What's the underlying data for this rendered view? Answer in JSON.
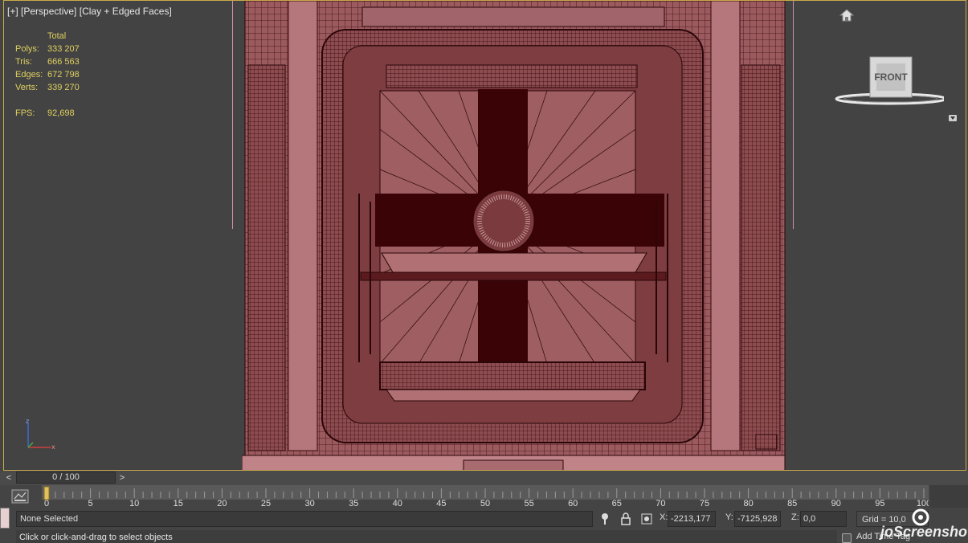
{
  "viewport": {
    "label_plus": "[+]",
    "label_view": "[Perspective]",
    "label_shading": "[Clay + Edged Faces]",
    "stats": {
      "header": "Total",
      "rows": [
        {
          "key": "Polys:",
          "value": "333 207"
        },
        {
          "key": "Tris:",
          "value": "666 563"
        },
        {
          "key": "Edges:",
          "value": "672 798"
        },
        {
          "key": "Verts:",
          "value": "339 270"
        }
      ],
      "fps_key": "FPS:",
      "fps_value": "92,698"
    },
    "viewcube_face": "FRONT",
    "home_icon": "home-icon"
  },
  "time_slider": {
    "prev": "<",
    "next": ">",
    "position": "0 / 100"
  },
  "track": {
    "ticks": [
      "0",
      "5",
      "10",
      "15",
      "20",
      "25",
      "30",
      "35",
      "40",
      "45",
      "50",
      "55",
      "60",
      "65",
      "70",
      "75",
      "80",
      "85",
      "90",
      "95",
      "100"
    ]
  },
  "status": {
    "selection": "None Selected",
    "prompt": "Click or click-and-drag to select objects",
    "x_label": "X:",
    "x_value": "-2213,177",
    "y_label": "Y:",
    "y_value": "-7125,928",
    "z_label": "Z:",
    "z_value": "0,0",
    "grid": "Grid = 10,0",
    "add_time_tag": "Add Time Tag",
    "watermark": "joScreenshot"
  },
  "colors": {
    "viewport_bg": "#434343",
    "viewport_border": "#c9a94a",
    "stats_text": "#e0d060",
    "model_fill": "#9a5a5e",
    "model_wire": "#3a0a0c"
  }
}
